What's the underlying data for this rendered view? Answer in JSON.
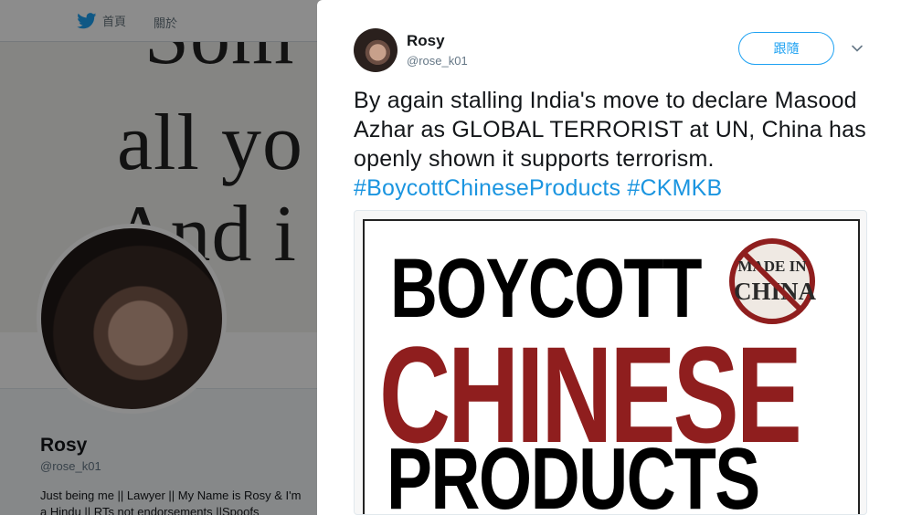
{
  "nav": {
    "home_label": "首頁",
    "about_label": "關於"
  },
  "background": {
    "quote_lines": [
      "Som",
      "all yo",
      "And i"
    ]
  },
  "profile": {
    "name": "Rosy",
    "handle": "@rose_k01",
    "bio": "Just being me || Lawyer || My Name is Rosy & I'm a Hindu || RTs not endorsements ||Spoofs"
  },
  "tweet": {
    "author_name": "Rosy",
    "author_handle": "@rose_k01",
    "follow_label": "跟隨",
    "text": "By again stalling India's move to declare Masood Azhar as GLOBAL TERRORIST at UN, China has openly shown it supports terrorism.",
    "hashtags": [
      "#BoycottChineseProducts",
      "#CKMKB"
    ]
  },
  "media": {
    "line1": "BOYCOTT",
    "line2": "CHINESE",
    "line3": "PRODUCTS",
    "stamp_line1": "MADE IN",
    "stamp_line2": "CHINA",
    "accent_red": "#8f1e1e"
  },
  "colors": {
    "twitter_blue": "#1da1f2",
    "hashtag_blue": "#1b95e0"
  }
}
